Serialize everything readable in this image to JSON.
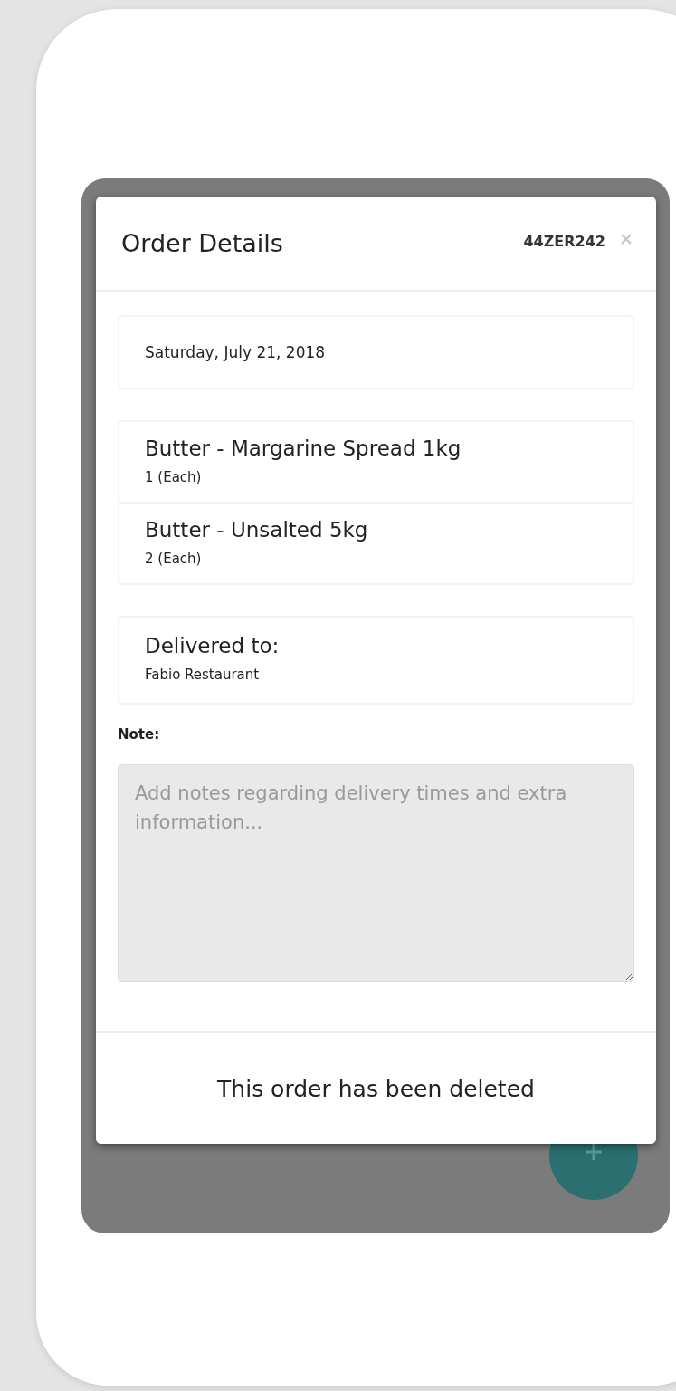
{
  "modal": {
    "title": "Order Details",
    "order_id": "44ZER242",
    "date": "Saturday, July 21, 2018",
    "items": [
      {
        "name": "Butter - Margarine Spread 1kg",
        "quantity": "1 (Each)"
      },
      {
        "name": "Butter - Unsalted 5kg",
        "quantity": "2 (Each)"
      }
    ],
    "delivery": {
      "label": "Delivered to:",
      "value": "Fabio Restaurant"
    },
    "note": {
      "label": "Note:",
      "placeholder": "Add notes regarding delivery times and extra information..."
    },
    "status_message": "This order has been deleted"
  }
}
